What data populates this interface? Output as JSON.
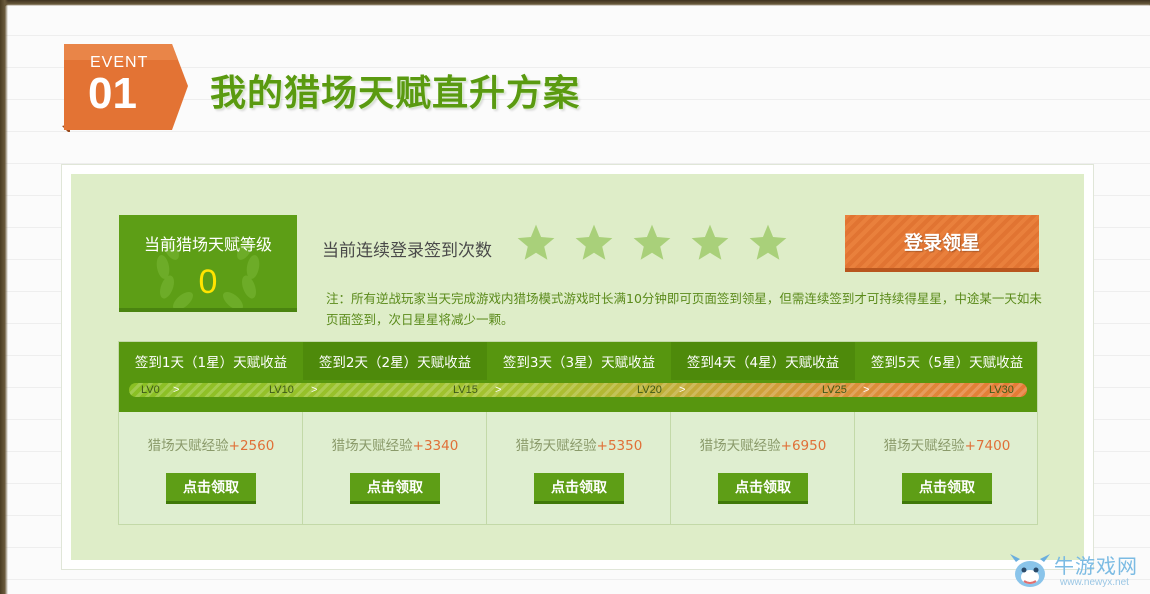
{
  "badge": {
    "label": "EVENT",
    "number": "01",
    "color": "#e37334"
  },
  "title": "我的猎场天赋直升方案",
  "level": {
    "label": "当前猎场天赋等级",
    "value": "0"
  },
  "streak": {
    "label": "当前连续登录签到次数",
    "stars_total": 5,
    "stars_filled": 0
  },
  "login_button": "登录领星",
  "note": "注：所有逆战玩家当天完成游戏内猎场模式游戏时长满10分钟即可页面签到领星，但需连续签到才可持续得星星，中途某一天如未页面签到，次日星星将减少一颗。",
  "rewards": {
    "columns": [
      {
        "header": "签到1天（1星）天赋收益",
        "exp_label": "猎场天赋经验",
        "exp_value": "+2560",
        "button": "点击领取"
      },
      {
        "header": "签到2天（2星）天赋收益",
        "exp_label": "猎场天赋经验",
        "exp_value": "+3340",
        "button": "点击领取"
      },
      {
        "header": "签到3天（3星）天赋收益",
        "exp_label": "猎场天赋经验",
        "exp_value": "+5350",
        "button": "点击领取"
      },
      {
        "header": "签到4天（4星）天赋收益",
        "exp_label": "猎场天赋经验",
        "exp_value": "+6950",
        "button": "点击领取"
      },
      {
        "header": "签到5天（5星）天赋收益",
        "exp_label": "猎场天赋经验",
        "exp_value": "+7400",
        "button": "点击领取"
      }
    ],
    "levels": [
      "LV0",
      "LV10",
      "LV15",
      "LV20",
      "LV25",
      "LV30"
    ],
    "arrow": ">"
  },
  "watermark": {
    "name": "牛游戏网",
    "url": "www.newyx.net",
    "icon": "mascot-icon"
  },
  "colors": {
    "green": "#5d9e16",
    "orange": "#e9803c",
    "star": "#a9d07a",
    "panel": "#deedc8"
  }
}
